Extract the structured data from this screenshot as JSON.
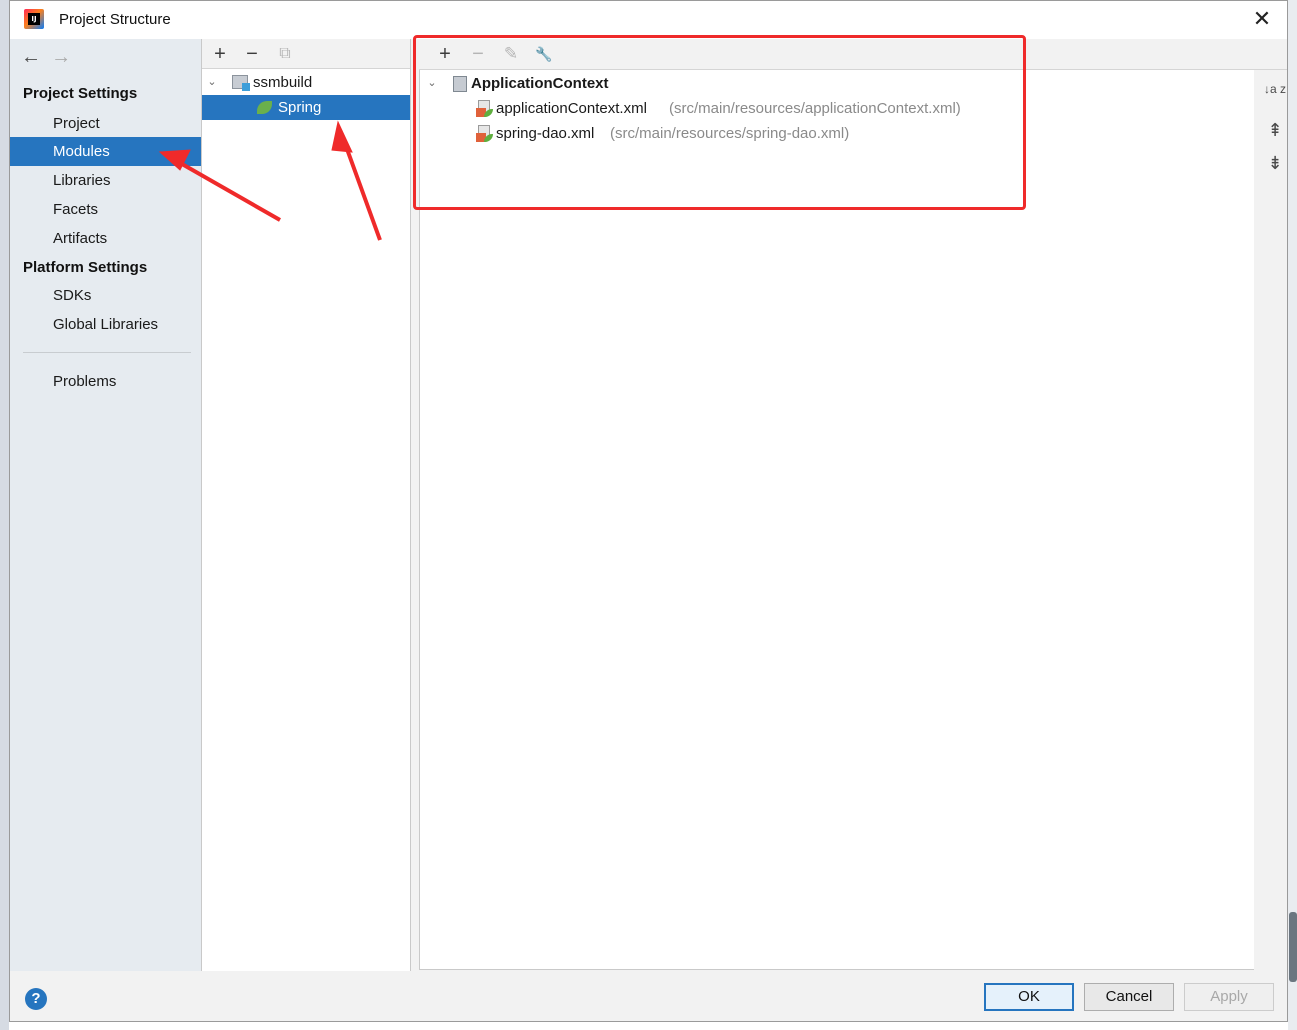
{
  "window": {
    "title": "Project Structure",
    "close_label": "✕"
  },
  "nav": {
    "back_label": "←",
    "forward_label": "→",
    "project_settings_heading": "Project Settings",
    "project_settings_items": [
      "Project",
      "Modules",
      "Libraries",
      "Facets",
      "Artifacts"
    ],
    "platform_settings_heading": "Platform Settings",
    "platform_settings_items": [
      "SDKs",
      "Global Libraries"
    ],
    "problems_label": "Problems",
    "selected_item": "Modules"
  },
  "module_tree": {
    "toolbar": {
      "add_label": "+",
      "remove_label": "−",
      "copy_label": "⧉"
    },
    "root": {
      "label": "ssmbuild",
      "expanded": true
    },
    "child": {
      "label": "Spring",
      "selected": true
    }
  },
  "spring_facet": {
    "toolbar": {
      "add_label": "+",
      "remove_label": "−",
      "edit_label": "✎",
      "settings_label": "🔧"
    },
    "fileset": {
      "label": "ApplicationContext",
      "expanded": true
    },
    "files": [
      {
        "name": "applicationContext.xml",
        "path": "(src/main/resources/applicationContext.xml)"
      },
      {
        "name": "spring-dao.xml",
        "path": "(src/main/resources/spring-dao.xml)"
      }
    ],
    "side_buttons": {
      "sort_label": "↓a z",
      "expand_label": "⇞",
      "collapse_label": "⇟"
    }
  },
  "footer": {
    "help_label": "?",
    "ok_label": "OK",
    "cancel_label": "Cancel",
    "apply_label": "Apply"
  },
  "colors": {
    "selection": "#2675bf",
    "annotation": "#ef2a2a",
    "nav_background": "#e6ebf0"
  }
}
